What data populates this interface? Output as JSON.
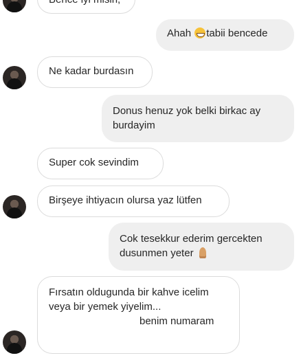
{
  "messages": [
    {
      "side": "in",
      "text": "Bence iyi misin,"
    },
    {
      "side": "out",
      "text_before": "Ahah",
      "text_after": "tabii bencede",
      "emoji": "grinning-face"
    },
    {
      "side": "in",
      "text": "Ne kadar burdasın"
    },
    {
      "side": "out",
      "text": "Donus henuz yok  belki birkac ay burdayim"
    },
    {
      "side": "in",
      "text": "Super  cok sevindim"
    },
    {
      "side": "in",
      "text": "Birşeye ihtiyacın olursa yaz lütfen"
    },
    {
      "side": "out",
      "line1": "Cok tesekkur ederim gercekten",
      "line2": "dusunmen yeter",
      "emoji": "folded-hands"
    },
    {
      "side": "in",
      "line1": "Fırsatın oldugunda bir kahve icelim",
      "line2": "veya bir yemek yiyelim...",
      "line3": "benim numaram"
    }
  ],
  "colors": {
    "incoming_border": "#dbdbdb",
    "outgoing_bg": "#efefef",
    "text": "#262626"
  }
}
